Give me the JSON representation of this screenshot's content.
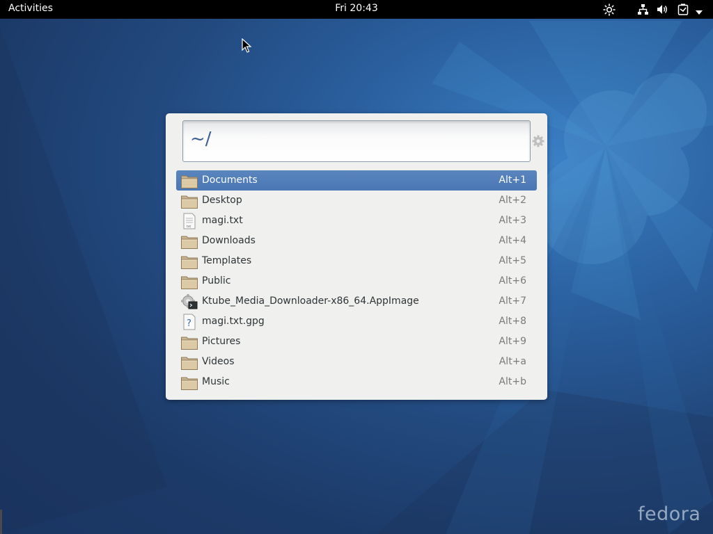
{
  "topbar": {
    "activities_label": "Activities",
    "clock": "Fri 20:43",
    "tray_icons": [
      "brightness-icon",
      "network-icon",
      "volume-icon",
      "battery-icon",
      "chevron-down-icon"
    ]
  },
  "launcher": {
    "query": "~/",
    "results": [
      {
        "name": "Documents",
        "shortcut": "Alt+1",
        "icon": "folder-icon",
        "selected": true
      },
      {
        "name": "Desktop",
        "shortcut": "Alt+2",
        "icon": "folder-icon"
      },
      {
        "name": "magi.txt",
        "shortcut": "Alt+3",
        "icon": "text-file-icon"
      },
      {
        "name": "Downloads",
        "shortcut": "Alt+4",
        "icon": "folder-icon"
      },
      {
        "name": "Templates",
        "shortcut": "Alt+5",
        "icon": "folder-icon"
      },
      {
        "name": "Public",
        "shortcut": "Alt+6",
        "icon": "folder-icon"
      },
      {
        "name": "Ktube_Media_Downloader-x86_64.AppImage",
        "shortcut": "Alt+7",
        "icon": "executable-icon"
      },
      {
        "name": "magi.txt.gpg",
        "shortcut": "Alt+8",
        "icon": "unknown-file-icon"
      },
      {
        "name": "Pictures",
        "shortcut": "Alt+9",
        "icon": "folder-icon"
      },
      {
        "name": "Videos",
        "shortcut": "Alt+a",
        "icon": "folder-icon"
      },
      {
        "name": "Music",
        "shortcut": "Alt+b",
        "icon": "folder-icon"
      }
    ]
  },
  "watermark": "fedora",
  "colors": {
    "topbar": "#000000",
    "selection": "#4a78b5",
    "query_text": "#3c5f92",
    "panel": "#f0f0ef"
  }
}
